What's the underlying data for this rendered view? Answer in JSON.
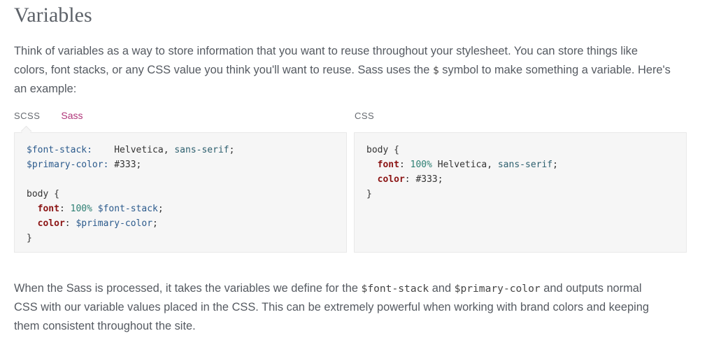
{
  "heading": "Variables",
  "intro": {
    "line1": "Think of variables as a way to store information that you want to reuse throughout your stylesheet. You can store things like",
    "line2_a": "colors, font stacks, or any CSS value you think you'll want to reuse. Sass uses the ",
    "line2_code": "$",
    "line2_b": " symbol to make something a variable. Here's",
    "line3": "an example:"
  },
  "tabs": {
    "scss": "SCSS",
    "sass": "Sass",
    "css": "CSS"
  },
  "scss_code": {
    "l1_var": "$font-stack:",
    "l1_gap": "    ",
    "l1_val": "Helvetica",
    "l1_comma": ", ",
    "l1_kw": "sans-serif",
    "l1_end": ";",
    "l2_var": "$primary-color:",
    "l2_gap": " ",
    "l2_val": "#333",
    "l2_end": ";",
    "l4_sel": "body",
    "l4_open": " {",
    "l5_indent": "  ",
    "l5_prop": "font",
    "l5_colon": ": ",
    "l5_num": "100%",
    "l5_sp": " ",
    "l5_var": "$font-stack",
    "l5_end": ";",
    "l6_indent": "  ",
    "l6_prop": "color",
    "l6_colon": ": ",
    "l6_var": "$primary-color",
    "l6_end": ";",
    "l7_close": "}"
  },
  "css_code": {
    "l1_sel": "body",
    "l1_open": " {",
    "l2_indent": "  ",
    "l2_prop": "font",
    "l2_colon": ": ",
    "l2_num": "100%",
    "l2_val": " Helvetica, ",
    "l2_kw": "sans-serif",
    "l2_end": ";",
    "l3_indent": "  ",
    "l3_prop": "color",
    "l3_colon": ": ",
    "l3_val": "#333",
    "l3_end": ";",
    "l4_close": "}"
  },
  "outro": {
    "line1_a": "When the Sass is processed, it takes the variables we define for the ",
    "line1_code1": "$font-stack",
    "line1_b": " and ",
    "line1_code2": "$primary-color",
    "line1_c": " and outputs normal",
    "line2": "CSS with our variable values placed in the CSS. This can be extremely powerful when working with brand colors and keeping",
    "line3": "them consistent throughout the site."
  },
  "colors": {
    "accent": "#b0367a",
    "text": "#555a61",
    "code_bg": "#f6f6f6"
  }
}
